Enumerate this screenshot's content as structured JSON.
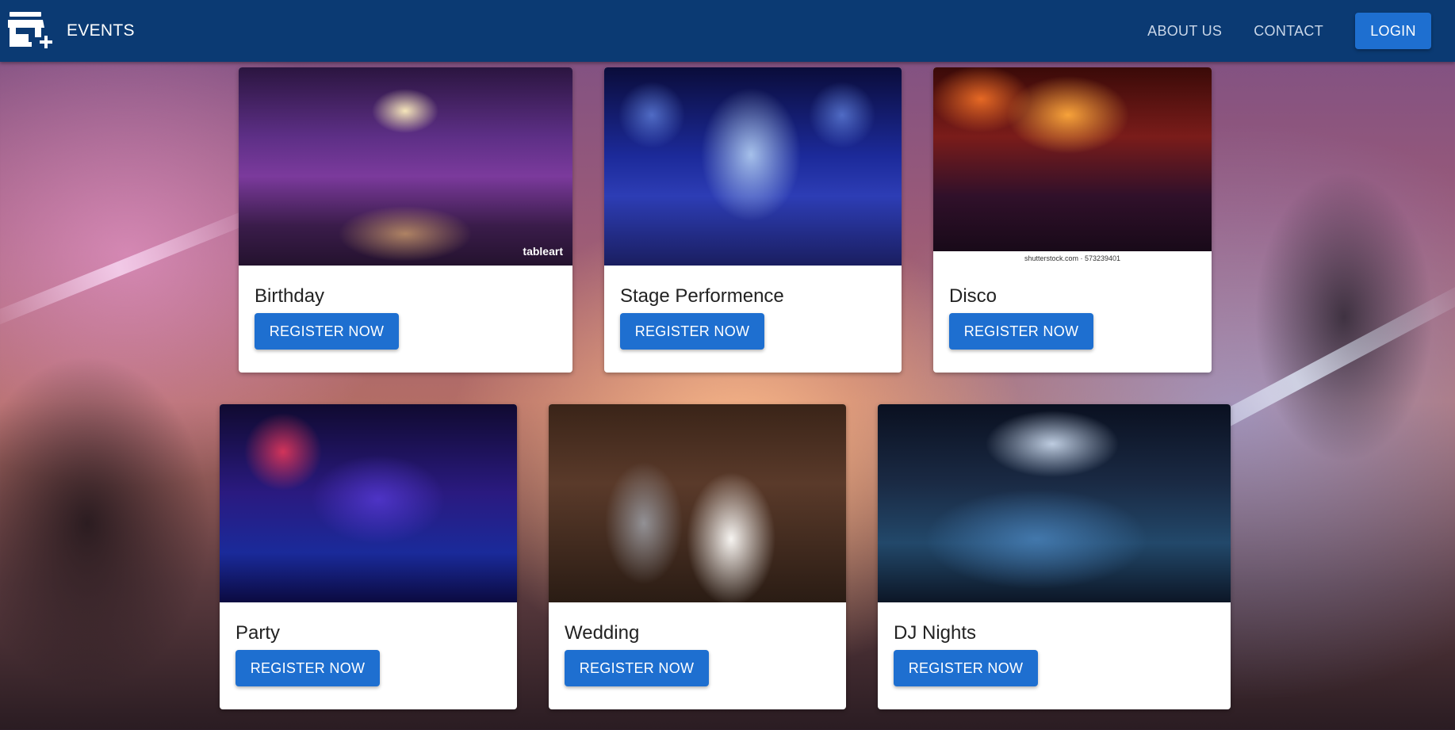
{
  "appbar": {
    "brand_icon": "store-add-icon",
    "title": "EVENTS",
    "nav": [
      {
        "label": "ABOUT US"
      },
      {
        "label": "CONTACT"
      }
    ],
    "login_label": "LOGIN",
    "color": "#0b3a73",
    "accent": "#1e6fd0"
  },
  "events": [
    {
      "title": "Birthday",
      "button": "REGISTER NOW",
      "image": "banquet-hall-image",
      "watermark": "tableart"
    },
    {
      "title": "Stage Performence",
      "button": "REGISTER NOW",
      "image": "stage-lights-image"
    },
    {
      "title": "Disco",
      "button": "REGISTER NOW",
      "image": "disco-crowd-image",
      "watermark": "shutterstock.com · 573239401"
    },
    {
      "title": "Party",
      "button": "REGISTER NOW",
      "image": "dancing-party-image"
    },
    {
      "title": "Wedding",
      "button": "REGISTER NOW",
      "image": "wedding-couple-image"
    },
    {
      "title": "DJ Nights",
      "button": "REGISTER NOW",
      "image": "dj-crowd-image"
    }
  ]
}
